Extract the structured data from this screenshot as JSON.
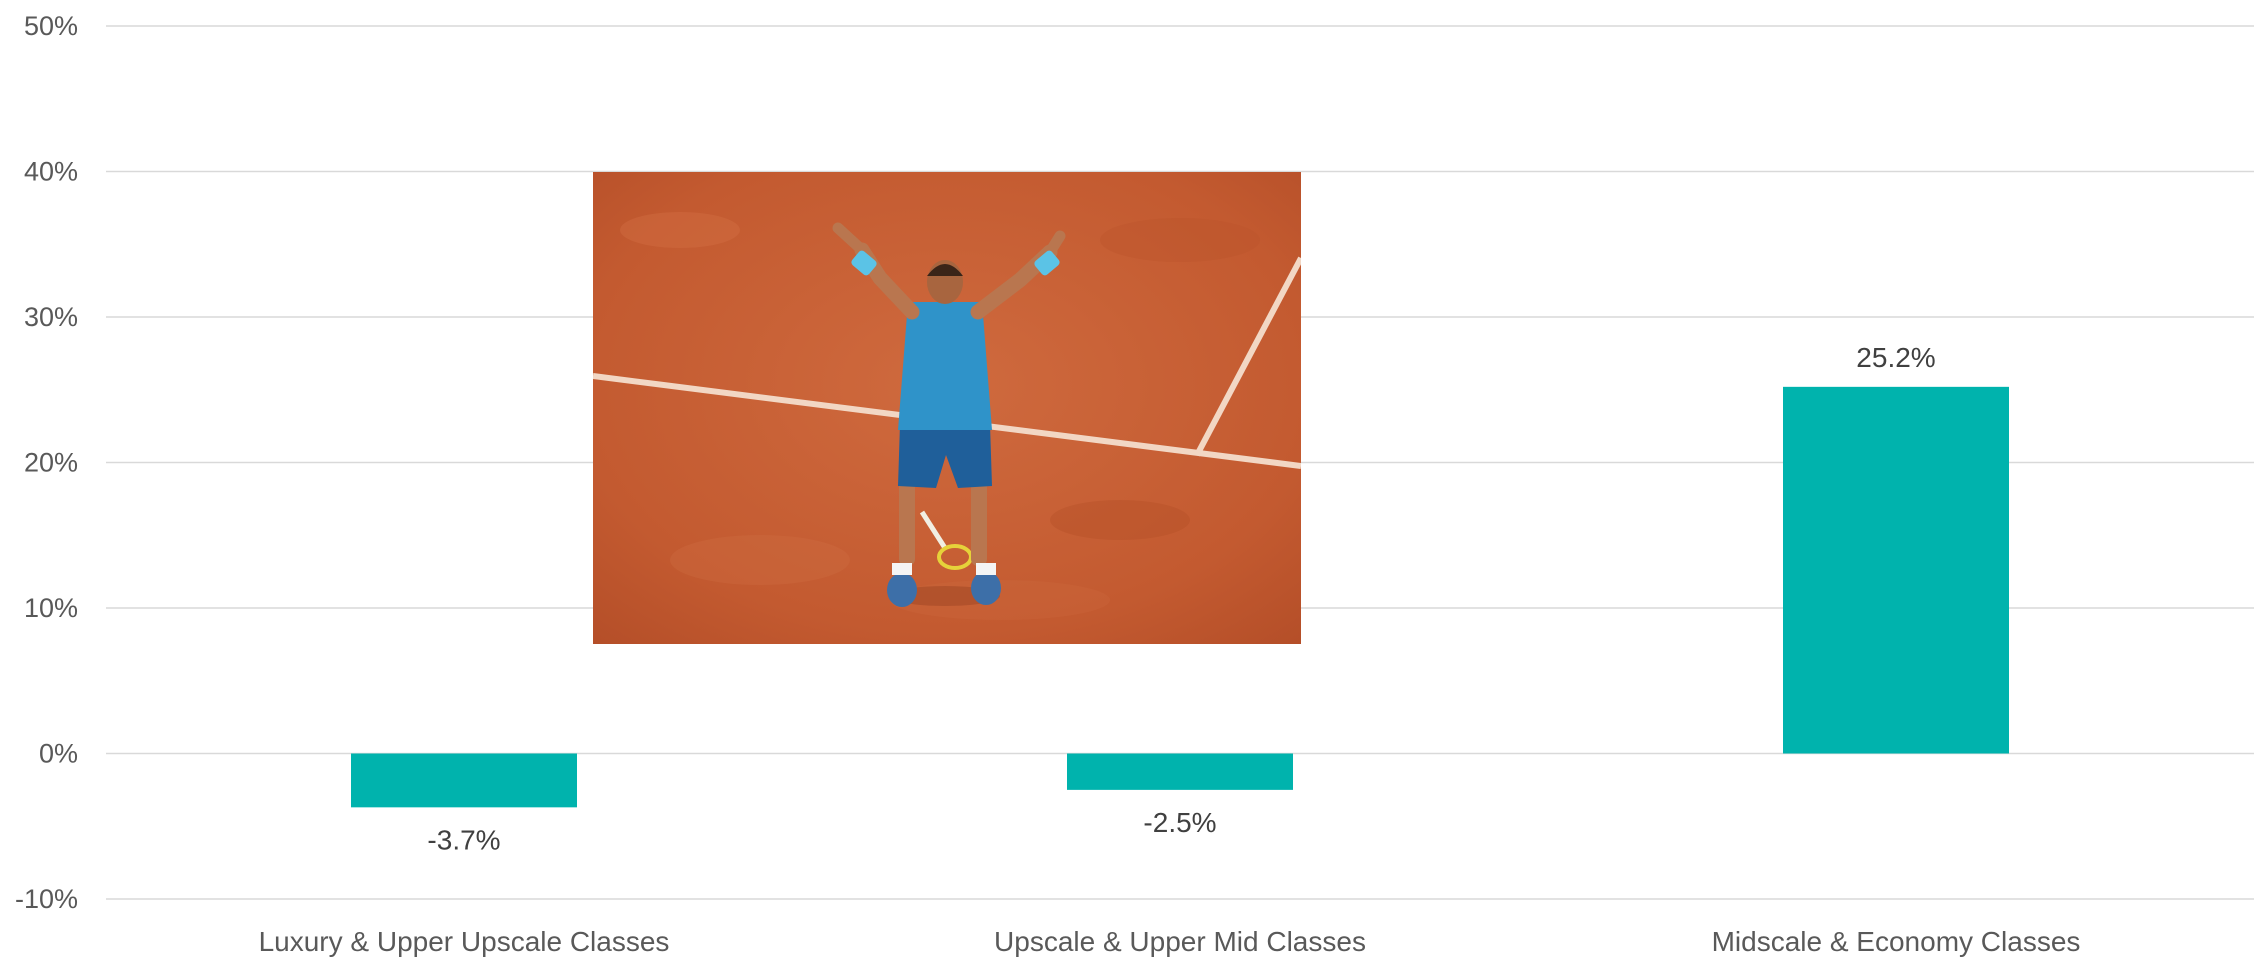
{
  "chart_data": {
    "type": "bar",
    "categories": [
      "Luxury & Upper Upscale Classes",
      "Upscale & Upper Mid Classes",
      "Midscale & Economy Classes"
    ],
    "values": [
      -3.7,
      -2.5,
      25.2
    ],
    "data_labels": [
      "-3.7%",
      "-2.5%",
      "25.2%"
    ],
    "ylim": [
      -10,
      50
    ],
    "yticks": [
      -10,
      0,
      10,
      20,
      30,
      40,
      50
    ],
    "ytick_labels": [
      "-10%",
      "0%",
      "10%",
      "20%",
      "30%",
      "40%",
      "50%"
    ],
    "grid": true,
    "bar_color": "#00b3ad",
    "title": "",
    "xlabel": "",
    "ylabel": ""
  },
  "overlay_photo": {
    "subject": "tennis-player-celebrating-on-clay-court-photo"
  }
}
